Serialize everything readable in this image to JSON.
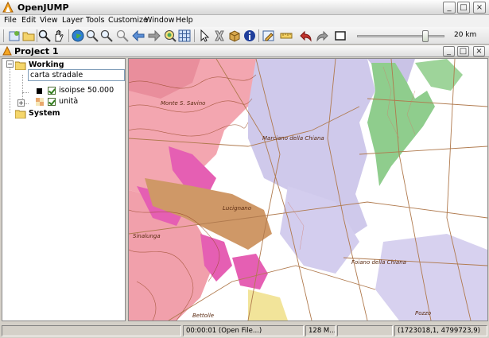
{
  "window": {
    "title": "OpenJUMP",
    "minimize_glyph": "_",
    "maximize_glyph": "□",
    "close_glyph": "×"
  },
  "menu": [
    "File",
    "Edit",
    "View",
    "Layer",
    "Tools",
    "Customize",
    "Window",
    "Help"
  ],
  "toolbar": {
    "icons": [
      "new-project-icon",
      "open-project-icon",
      "zoom-icon",
      "pan-hand-icon",
      "globe-zoom-full-icon",
      "zoom-in-icon",
      "zoom-out-icon",
      "zoom-selected-icon",
      "back-arrow-icon",
      "forward-arrow-icon",
      "zoom-layer-icon",
      "grid-icon",
      "select-arrow-icon",
      "delete-icon",
      "feature-info-box-icon",
      "info-icon",
      "edit-pencil-icon",
      "measure-ruler-icon",
      "undo-icon",
      "redo-icon",
      "rectangle-icon"
    ],
    "zoom_level": 0.78,
    "scale_label": "20 km"
  },
  "project": {
    "title": "Project  1",
    "categories": [
      {
        "name": "Working",
        "editing_value": "carta stradale",
        "layers": [
          {
            "name": "isoipse 50.000",
            "checked": true,
            "swatch": "#000000"
          },
          {
            "name": "unità",
            "checked": true,
            "swatch": "grid"
          }
        ]
      },
      {
        "name": "System",
        "layers": []
      }
    ]
  },
  "map": {
    "place_labels": [
      "Monte S. Savino",
      "Marciano della Chiana",
      "Lucignano",
      "Sinalunga",
      "Foiano della Chiana",
      "Bettolle",
      "Pozzo"
    ],
    "colors": {
      "pink": "#f3a6b0",
      "magenta": "#e55fb3",
      "lavender": "#c9c3e6",
      "green": "#8fcd8d",
      "tan": "#c98e5c",
      "road": "#b07a4e",
      "contour": "#9a4a2a"
    }
  },
  "status": {
    "message": "",
    "timer": "00:00:01 (Open File...)",
    "memory": "128 M...",
    "empty": "",
    "coordinates": "(1723018,1, 4799723,9)"
  }
}
